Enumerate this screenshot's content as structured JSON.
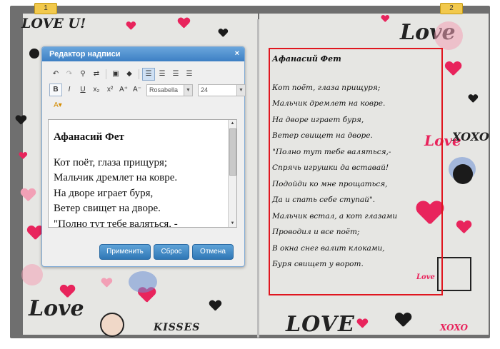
{
  "book": {
    "page_numbers": [
      "1",
      "2"
    ]
  },
  "dialog": {
    "title": "Редактор надписи",
    "close_glyph": "×",
    "font_family": "Rosabella",
    "font_size": "24",
    "buttons": {
      "apply": "Применить",
      "reset": "Сброс",
      "cancel": "Отмена"
    },
    "editor_lines": [
      "Афанасий Фет",
      "Кот поёт, глаза прищуря;",
      "Мальчик дремлет на ковре.",
      "На дворе играет буря,",
      "Ветер свищет на дворе.",
      "\"Полно тут тебе валяться, -"
    ]
  },
  "poem": {
    "title": "Афанасий Фет",
    "lines": [
      "Кот поёт, глаза прищуря;",
      "Мальчик дремлет на ковре.",
      "На дворе играет буря,",
      "Ветер свищет на дворе.",
      "\"Полно тут тебе валяться,-",
      "Спрячь игрушки да вставай!",
      "Подойди ко мне прощаться,",
      "Да и спать себе ступай\".",
      "Мальчик встал, а кот глазами",
      "Проводил и все поёт;",
      "В окна снег валит клоками,",
      "Буря свищет у ворот."
    ]
  },
  "decor_text": {
    "love_u": "LOVE U!",
    "love": "Love",
    "love2": "LOVE",
    "kisses": "KISSES",
    "xoxo": "XOXO",
    "love_you": "Love"
  },
  "colors": {
    "accent_blue": "#3d7fc4",
    "frame_red": "#e0161f",
    "heart_red": "#e8245c"
  }
}
